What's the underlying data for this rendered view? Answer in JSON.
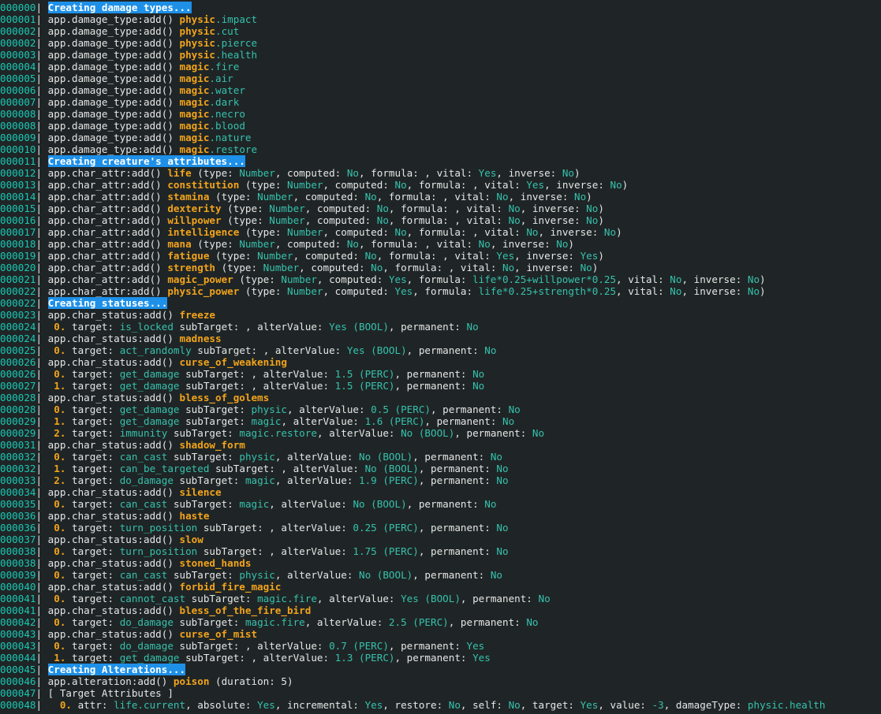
{
  "terminal": {
    "lines": [
      {
        "n": "000000",
        "t": "header",
        "text": "Creating damage types..."
      },
      {
        "n": "000001",
        "t": "dmg",
        "a": "physic",
        "b": "impact"
      },
      {
        "n": "000002",
        "t": "dmg",
        "a": "physic",
        "b": "cut"
      },
      {
        "n": "000002",
        "t": "dmg",
        "a": "physic",
        "b": "pierce"
      },
      {
        "n": "000003",
        "t": "dmg",
        "a": "physic",
        "b": "health"
      },
      {
        "n": "000004",
        "t": "dmg",
        "a": "magic",
        "b": "fire"
      },
      {
        "n": "000005",
        "t": "dmg",
        "a": "magic",
        "b": "air"
      },
      {
        "n": "000006",
        "t": "dmg",
        "a": "magic",
        "b": "water"
      },
      {
        "n": "000007",
        "t": "dmg",
        "a": "magic",
        "b": "dark"
      },
      {
        "n": "000008",
        "t": "dmg",
        "a": "magic",
        "b": "necro"
      },
      {
        "n": "000008",
        "t": "dmg",
        "a": "magic",
        "b": "blood"
      },
      {
        "n": "000009",
        "t": "dmg",
        "a": "magic",
        "b": "nature"
      },
      {
        "n": "000010",
        "t": "dmg",
        "a": "magic",
        "b": "restore"
      },
      {
        "n": "000011",
        "t": "header",
        "text": "Creating creature's attributes..."
      },
      {
        "n": "000012",
        "t": "attr",
        "name": "life",
        "type": "Number",
        "computed": "No",
        "formula": "",
        "vital": "Yes",
        "inverse": "No"
      },
      {
        "n": "000013",
        "t": "attr",
        "name": "constitution",
        "type": "Number",
        "computed": "No",
        "formula": "",
        "vital": "Yes",
        "inverse": "No"
      },
      {
        "n": "000014",
        "t": "attr",
        "name": "stamina",
        "type": "Number",
        "computed": "No",
        "formula": "",
        "vital": "No",
        "inverse": "No"
      },
      {
        "n": "000015",
        "t": "attr",
        "name": "dexterity",
        "type": "Number",
        "computed": "No",
        "formula": "",
        "vital": "No",
        "inverse": "No"
      },
      {
        "n": "000016",
        "t": "attr",
        "name": "willpower",
        "type": "Number",
        "computed": "No",
        "formula": "",
        "vital": "No",
        "inverse": "No"
      },
      {
        "n": "000017",
        "t": "attr",
        "name": "intelligence",
        "type": "Number",
        "computed": "No",
        "formula": "",
        "vital": "No",
        "inverse": "No"
      },
      {
        "n": "000018",
        "t": "attr",
        "name": "mana",
        "type": "Number",
        "computed": "No",
        "formula": "",
        "vital": "No",
        "inverse": "No"
      },
      {
        "n": "000019",
        "t": "attr",
        "name": "fatigue",
        "type": "Number",
        "computed": "No",
        "formula": "",
        "vital": "Yes",
        "inverse": "Yes"
      },
      {
        "n": "000020",
        "t": "attr",
        "name": "strength",
        "type": "Number",
        "computed": "No",
        "formula": "",
        "vital": "No",
        "inverse": "No"
      },
      {
        "n": "000021",
        "t": "attr",
        "name": "magic_power",
        "type": "Number",
        "computed": "Yes",
        "formula": "life*0.25+willpower*0.25",
        "vital": "No",
        "inverse": "No"
      },
      {
        "n": "000022",
        "t": "attr",
        "name": "physic_power",
        "type": "Number",
        "computed": "Yes",
        "formula": "life*0.25+strength*0.25",
        "vital": "No",
        "inverse": "No"
      },
      {
        "n": "000022",
        "t": "header",
        "text": "Creating statuses..."
      },
      {
        "n": "000023",
        "t": "status",
        "name": "freeze"
      },
      {
        "n": "000024",
        "t": "eff",
        "i": "0.",
        "target": "is_locked",
        "sub": "",
        "val": "Yes (BOOL)",
        "perm": "No"
      },
      {
        "n": "000024",
        "t": "status",
        "name": "madness"
      },
      {
        "n": "000025",
        "t": "eff",
        "i": "0.",
        "target": "act_randomly",
        "sub": "",
        "val": "Yes (BOOL)",
        "perm": "No"
      },
      {
        "n": "000026",
        "t": "status",
        "name": "curse_of_weakening"
      },
      {
        "n": "000026",
        "t": "eff",
        "i": "0.",
        "target": "get_damage",
        "sub": "",
        "val": "1.5 (PERC)",
        "perm": "No"
      },
      {
        "n": "000027",
        "t": "eff",
        "i": "1.",
        "target": "get_damage",
        "sub": "",
        "val": "1.5 (PERC)",
        "perm": "No"
      },
      {
        "n": "000028",
        "t": "status",
        "name": "bless_of_golems"
      },
      {
        "n": "000028",
        "t": "eff",
        "i": "0.",
        "target": "get_damage",
        "sub": "physic",
        "val": "0.5 (PERC)",
        "perm": "No"
      },
      {
        "n": "000029",
        "t": "eff",
        "i": "1.",
        "target": "get_damage",
        "sub": "magic",
        "val": "1.6 (PERC)",
        "perm": "No"
      },
      {
        "n": "000029",
        "t": "eff",
        "i": "2.",
        "target": "immunity",
        "sub": "magic.restore",
        "val": "No (BOOL)",
        "perm": "No"
      },
      {
        "n": "000031",
        "t": "status",
        "name": "shadow_form"
      },
      {
        "n": "000032",
        "t": "eff",
        "i": "0.",
        "target": "can_cast",
        "sub": "physic",
        "val": "No (BOOL)",
        "perm": "No"
      },
      {
        "n": "000032",
        "t": "eff",
        "i": "1.",
        "target": "can_be_targeted",
        "sub": "",
        "val": "No (BOOL)",
        "perm": "No"
      },
      {
        "n": "000033",
        "t": "eff",
        "i": "2.",
        "target": "do_damage",
        "sub": "magic",
        "val": "1.9 (PERC)",
        "perm": "No"
      },
      {
        "n": "000034",
        "t": "status",
        "name": "silence"
      },
      {
        "n": "000035",
        "t": "eff",
        "i": "0.",
        "target": "can_cast",
        "sub": "magic",
        "val": "No (BOOL)",
        "perm": "No"
      },
      {
        "n": "000036",
        "t": "status",
        "name": "haste"
      },
      {
        "n": "000036",
        "t": "eff",
        "i": "0.",
        "target": "turn_position",
        "sub": "",
        "val": "0.25 (PERC)",
        "perm": "No"
      },
      {
        "n": "000037",
        "t": "status",
        "name": "slow"
      },
      {
        "n": "000038",
        "t": "eff",
        "i": "0.",
        "target": "turn_position",
        "sub": "",
        "val": "1.75 (PERC)",
        "perm": "No"
      },
      {
        "n": "000038",
        "t": "status",
        "name": "stoned_hands"
      },
      {
        "n": "000039",
        "t": "eff",
        "i": "0.",
        "target": "can_cast",
        "sub": "physic",
        "val": "No (BOOL)",
        "perm": "No"
      },
      {
        "n": "000040",
        "t": "status",
        "name": "forbid_fire_magic"
      },
      {
        "n": "000041",
        "t": "eff",
        "i": "0.",
        "target": "cannot_cast",
        "sub": "magic.fire",
        "val": "Yes (BOOL)",
        "perm": "No"
      },
      {
        "n": "000041",
        "t": "status",
        "name": "bless_of_the_fire_bird"
      },
      {
        "n": "000042",
        "t": "eff",
        "i": "0.",
        "target": "do_damage",
        "sub": "magic.fire",
        "val": "2.5 (PERC)",
        "perm": "No"
      },
      {
        "n": "000043",
        "t": "status",
        "name": "curse_of_mist"
      },
      {
        "n": "000043",
        "t": "eff",
        "i": "0.",
        "target": "do_damage",
        "sub": "",
        "val": "0.7 (PERC)",
        "perm": "Yes"
      },
      {
        "n": "000044",
        "t": "eff",
        "i": "1.",
        "target": "get_damage",
        "sub": "",
        "val": "1.3 (PERC)",
        "perm": "Yes"
      },
      {
        "n": "000045",
        "t": "header",
        "text": "Creating Alterations..."
      },
      {
        "n": "000046",
        "t": "alter",
        "name": "poison",
        "duration": "5"
      },
      {
        "n": "000047",
        "t": "plain",
        "text": "[ Target Attributes ]"
      },
      {
        "n": "000048",
        "t": "alt_attr",
        "i": "0.",
        "attr": "life.current",
        "absolute": "Yes",
        "incremental": "Yes",
        "restore": "No",
        "self": "No",
        "target": "Yes",
        "value": "-3",
        "damageType": "physic.health"
      }
    ]
  }
}
